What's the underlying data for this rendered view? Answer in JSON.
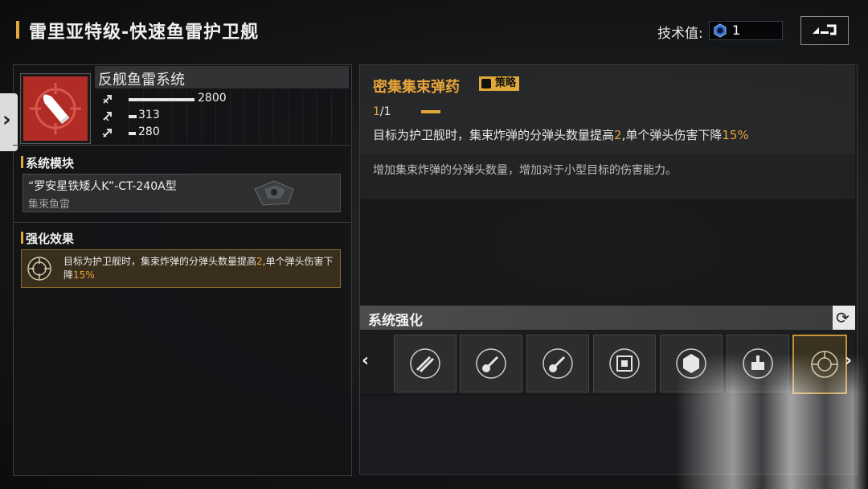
{
  "header": {
    "title": "雷里亚特级-快速鱼雷护卫舰",
    "tech_label": "技术值:",
    "tech_value": "1"
  },
  "weapon": {
    "name": "反舰鱼雷系统",
    "icon": "torpedo-shell-icon",
    "stats": [
      {
        "icon": "damage-arrow-icon",
        "value": "2800",
        "fill": 0.9
      },
      {
        "icon": "range-arrow-icon",
        "value": "313",
        "fill": 0.11
      },
      {
        "icon": "speed-arrow-icon",
        "value": "280",
        "fill": 0.1
      }
    ]
  },
  "module_section": {
    "title": "系统模块",
    "module_name": "“罗安星铁矮人K”-CT-240A型",
    "module_type": "集束鱼雷"
  },
  "effect_section": {
    "title": "强化效果",
    "text_pre": "目标为护卫舰时，集束炸弹的分弹头数量提高",
    "num1": "2",
    "text_mid": ",单个弹头伤害下降",
    "num2": "15%"
  },
  "upgrade": {
    "title": "密集集束弹药",
    "tag": "策略",
    "level_current": "1",
    "level_total": "/1",
    "desc_pre": "目标为护卫舰时，集束炸弹的分弹头数量提高",
    "desc_num1": "2",
    "desc_mid": ",单个弹头伤害下降",
    "desc_num2": "15%",
    "flavor": "增加集束炸弹的分弹头数量，增加对于小型目标的伤害能力。"
  },
  "system_upgrades": {
    "title": "系统强化",
    "slots": [
      "missile-pair-icon",
      "missile-guitar-icon",
      "missile-guitar-icon",
      "chip-icon",
      "shield-hex-icon",
      "turret-icon",
      "crosshair-shield-icon"
    ],
    "selected_index": 6
  },
  "colors": {
    "accent": "#e0a83a",
    "weapon_red": "#b02c24"
  }
}
